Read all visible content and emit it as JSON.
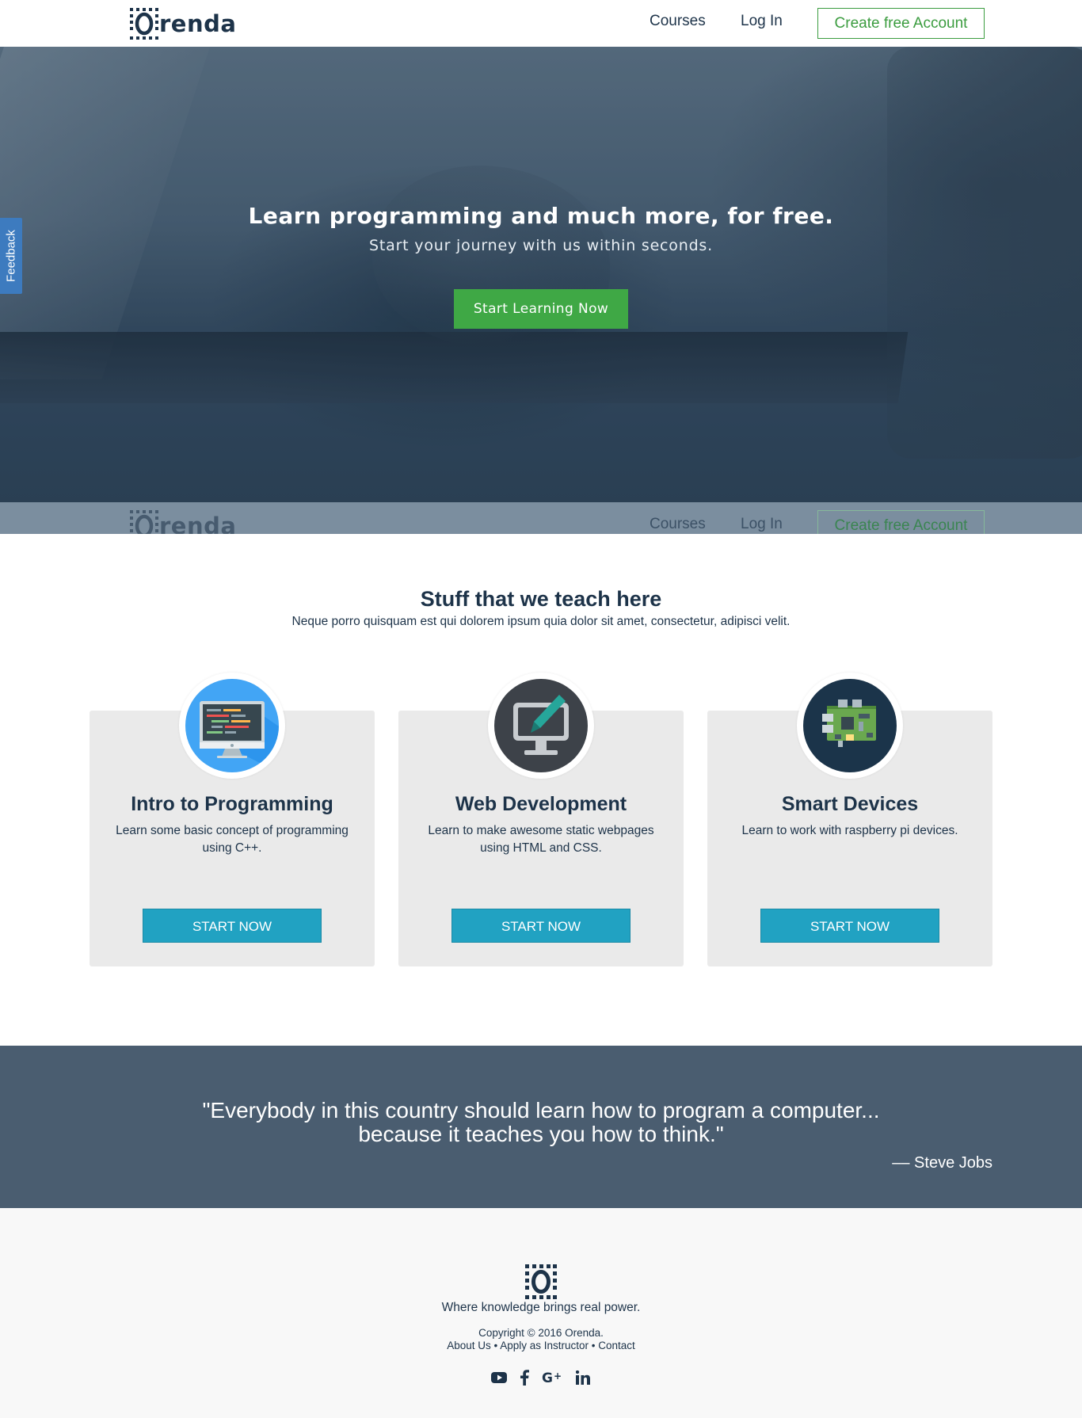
{
  "brand": {
    "name": "renda"
  },
  "nav": {
    "courses": "Courses",
    "login": "Log In",
    "signup": "Create free Account"
  },
  "hero": {
    "title": "Learn programming and much more, for free.",
    "subtitle": "Start your journey with us within seconds.",
    "cta": "Start Learning Now"
  },
  "feedback": {
    "label": "Feedback"
  },
  "courses_section": {
    "title": "Stuff that we teach here",
    "subtitle": "Neque porro quisquam est qui dolorem ipsum quia dolor sit amet, consectetur, adipisci velit.",
    "cards": [
      {
        "title": "Intro to Programming",
        "desc": "Learn some basic concept of programming using C++.",
        "button": "START NOW",
        "icon": "computer-code-icon",
        "color": "#42a5f5"
      },
      {
        "title": "Web Development",
        "desc": "Learn to make awesome static webpages using HTML and CSS.",
        "button": "START NOW",
        "icon": "monitor-pen-icon",
        "color": "#3d4249"
      },
      {
        "title": "Smart Devices",
        "desc": "Learn to work with raspberry pi devices.",
        "button": "START NOW",
        "icon": "circuit-board-icon",
        "color": "#1b344a"
      }
    ]
  },
  "quote": {
    "line1": "\"Everybody in this country should learn how to program a computer...",
    "line2": "because it teaches you how to think.\"",
    "author": "–– Steve Jobs"
  },
  "footer": {
    "tagline": "Where knowledge brings real power.",
    "copyright": "Copyright © 2016 Orenda.",
    "links": [
      "About Us",
      "Apply as Instructor",
      "Contact"
    ],
    "separator": " • ",
    "social": [
      "youtube-icon",
      "facebook-icon",
      "google-plus-icon",
      "linkedin-icon"
    ]
  },
  "colors": {
    "brand_navy": "#1d3349",
    "accent_green": "#3fa845",
    "button_teal": "#21a2c2",
    "quote_bg": "#4a5d70",
    "feedback_blue": "#3d7bbf"
  }
}
